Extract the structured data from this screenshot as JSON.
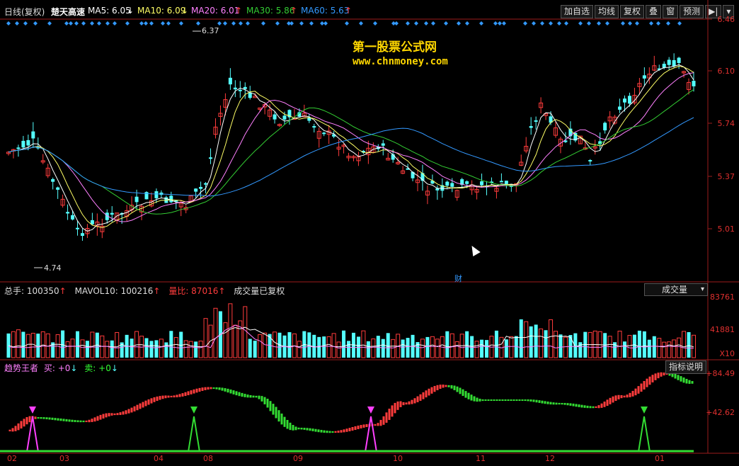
{
  "header": {
    "period": "日线(复权)",
    "stock_name": "楚天高速",
    "ma5": "MA5: 6.05",
    "ma10": "MA10: 6.09",
    "ma20": "MA20: 6.01",
    "ma30": "MA30: 5.86",
    "ma60": "MA60: 5.63"
  },
  "toolbar": {
    "add_watch": "加自选",
    "ma_line": "均线",
    "restore": "复权",
    "overlay": "叠",
    "window": "窗",
    "forecast": "预测"
  },
  "watermark": {
    "title": "第一股票公式网",
    "url": "www.chnmoney.com"
  },
  "price_axis": [
    "6.46",
    "6.10",
    "5.74",
    "5.37",
    "5.01"
  ],
  "annotations": {
    "high": "6.37",
    "low": "4.74",
    "finance_marker": "财"
  },
  "volume_pane": {
    "total": "总手: 100350",
    "mavol": "MAVOL10: 100216",
    "ratio": "量比: 87016",
    "note": "成交量已复权",
    "selector": "成交量",
    "axis": [
      "83761",
      "41881"
    ],
    "unit": "X10"
  },
  "indicator_pane": {
    "name": "趋势王者",
    "buy": "买: +0",
    "sell": "卖: +0",
    "help_button": "指标说明",
    "axis": [
      "+84.49",
      "+42.62"
    ]
  },
  "months": [
    "02",
    "03",
    "04",
    "08",
    "09",
    "10",
    "11",
    "12",
    "01"
  ],
  "colors": {
    "up": "#ff3c3c",
    "down": "#54ffff",
    "ma5": "#ffffff",
    "ma10": "#ffff66",
    "ma20": "#ff80ff",
    "ma30": "#33cc33",
    "ma60": "#3399ff",
    "grid": "#9b1c1c",
    "axis_text": "#e0302f"
  }
}
